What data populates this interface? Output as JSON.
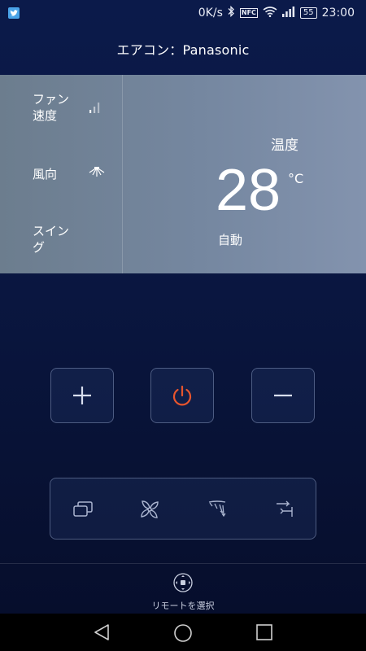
{
  "status": {
    "net_speed": "0K/s",
    "nfc_label": "NFC",
    "battery": "55",
    "time": "23:00"
  },
  "header": {
    "title": "エアコン：Panasonic"
  },
  "options": [
    {
      "label": "ファン\n速度",
      "icon": "fan-speed-bars-icon"
    },
    {
      "label": "風向",
      "icon": "wind-direction-icon"
    },
    {
      "label": "スイン\nグ",
      "icon": ""
    }
  ],
  "temperature": {
    "label": "温度",
    "value": "28",
    "unit": "°C",
    "mode": "自動"
  },
  "controls": {
    "plus": "plus-icon",
    "power": "power-icon",
    "minus": "minus-icon",
    "power_color": "#e8552d"
  },
  "toolbar": [
    "window-icon",
    "fan-icon",
    "swing-icon",
    "wind-direction-icon"
  ],
  "footer": {
    "remote_label": "リモートを選択"
  }
}
